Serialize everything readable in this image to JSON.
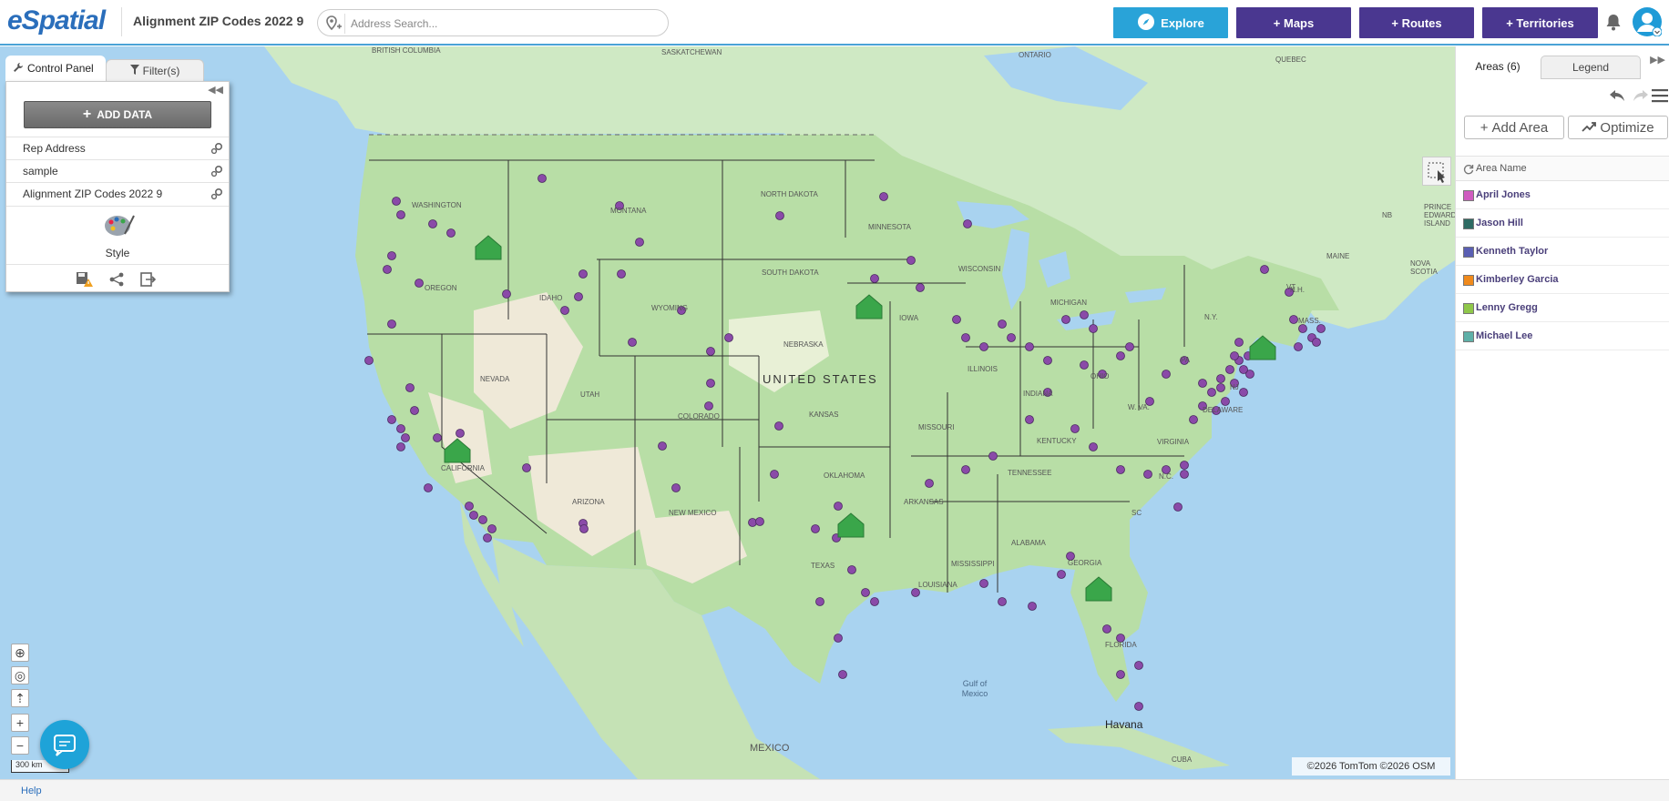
{
  "header": {
    "logo": "eSpatial",
    "document_title": "Alignment ZIP Codes 2022 9",
    "search_placeholder": "Address Search...",
    "buttons": {
      "explore": "Explore",
      "maps": "+ Maps",
      "routes": "+ Routes",
      "territories": "+ Territories"
    },
    "colors": {
      "accent": "#29a3d8",
      "primary": "#4a3790"
    }
  },
  "control_panel": {
    "tabs": {
      "active": "Control Panel",
      "filters": "Filter(s)"
    },
    "add_data_label": "ADD DATA",
    "layers": [
      {
        "label": "Rep Address"
      },
      {
        "label": "sample"
      },
      {
        "label": "Alignment ZIP Codes 2022 9"
      }
    ],
    "style_label": "Style"
  },
  "right_panel": {
    "tabs": {
      "areas": "Areas (6)",
      "legend": "Legend"
    },
    "add_area_label": "Add Area",
    "optimize_label": "Optimize",
    "column_header": "Area Name",
    "areas": [
      {
        "name": "April Jones",
        "color": "#cf5cc0"
      },
      {
        "name": "Jason Hill",
        "color": "#2e6b63"
      },
      {
        "name": "Kenneth Taylor",
        "color": "#5a5fb3"
      },
      {
        "name": "Kimberley Garcia",
        "color": "#f08a1c"
      },
      {
        "name": "Lenny Gregg",
        "color": "#8fc74a"
      },
      {
        "name": "Michael Lee",
        "color": "#5fb0a8"
      }
    ]
  },
  "map": {
    "country_label": "UNITED STATES",
    "labels": [
      "BRITISH COLUMBIA",
      "SASKATCHEWAN",
      "ONTARIO",
      "QUEBEC",
      "WASHINGTON",
      "MONTANA",
      "NORTH DAKOTA",
      "MINNESOTA",
      "OREGON",
      "IDAHO",
      "WYOMING",
      "SOUTH DAKOTA",
      "WISCONSIN",
      "MICHIGAN",
      "MAINE",
      "NB",
      "PRINCE EDWARD ISLAND",
      "NOVA SCOTIA",
      "VT",
      "N.H.",
      "N.Y.",
      "MASS.",
      "IOWA",
      "NEBRASKA",
      "NEVADA",
      "UTAH",
      "COLORADO",
      "KANSAS",
      "ILLINOIS",
      "INDIANA",
      "OHIO",
      "PA",
      "NJ",
      "W. VA.",
      "DELAWARE",
      "VIRGINIA",
      "MISSOURI",
      "KENTUCKY",
      "CALIFORNIA",
      "ARIZONA",
      "NEW MEXICO",
      "OKLAHOMA",
      "ARKANSAS",
      "TENNESSEE",
      "N.C.",
      "SC",
      "MISSISSIPPI",
      "ALABAMA",
      "GEORGIA",
      "TEXAS",
      "LOUISIANA",
      "FLORIDA",
      "Gulf of Mexico",
      "Havana",
      "CUBA",
      "MEXICO"
    ],
    "scale_label": "300 km",
    "attribution": "©2026 TomTom ©2026 OSM",
    "colors": {
      "marker": "#8a4aa8",
      "home": "#3aa64a"
    }
  },
  "footer": {
    "help_label": "Help"
  }
}
